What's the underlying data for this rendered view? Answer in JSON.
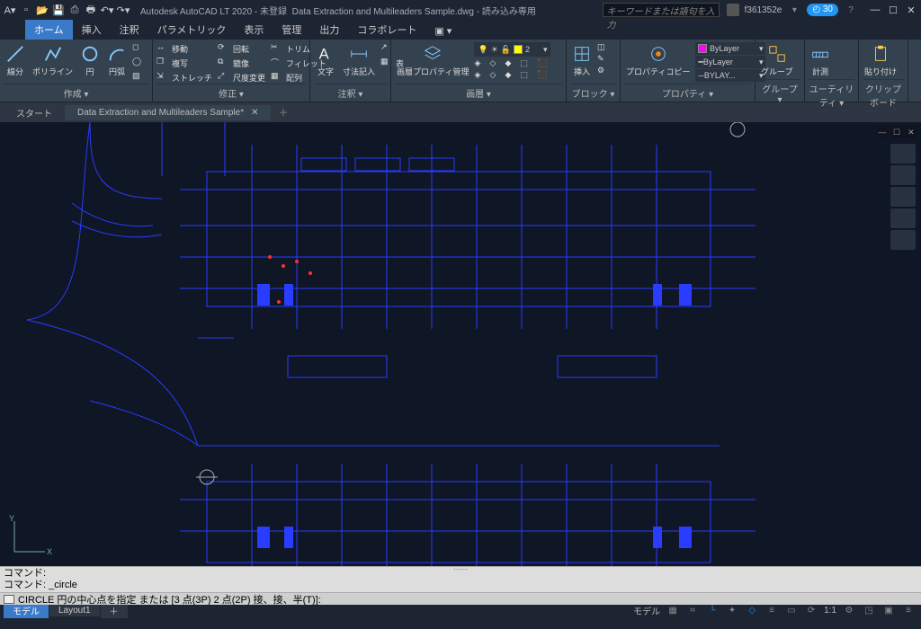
{
  "app": {
    "title": "Autodesk AutoCAD LT 2020 - 未登録",
    "file": "Data Extraction and Multileaders Sample.dwg",
    "readonly": "読み込み専用",
    "search_placeholder": "キーワードまたは語句を入力",
    "user": "f361352e",
    "badge": "30"
  },
  "ribbon": {
    "tabs": [
      "ホーム",
      "挿入",
      "注釈",
      "パラメトリック",
      "表示",
      "管理",
      "出力",
      "コラボレート"
    ],
    "active": 0,
    "panels": {
      "create": "作成 ▾",
      "modify": "修正 ▾",
      "anno": "注釈 ▾",
      "layer": "画層 ▾",
      "block": "ブロック ▾",
      "prop": "プロパティ ▾",
      "group": "グループ ▾",
      "util": "ユーティリティ ▾",
      "clip": "クリップボード"
    },
    "tools": {
      "line": "線分",
      "polyline": "ポリライン",
      "circle": "円",
      "arc": "円弧",
      "move": "移動",
      "rotate": "回転",
      "trim": "トリム",
      "copy": "複写",
      "mirror": "鏡像",
      "fillet": "フィレット",
      "stretch": "ストレッチ",
      "scale": "尺度変更",
      "array": "配列",
      "text": "文字",
      "dim": "寸法記入",
      "table": "表",
      "layerprop": "画層プロパティ管理",
      "insert": "挿入",
      "propcopy": "プロパティコピー",
      "group_btn": "グループ",
      "measure": "計測",
      "paste": "貼り付け",
      "bylayer": "ByLayer",
      "bylay2": "BYLAY..."
    },
    "current_layer": "2"
  },
  "docs": {
    "start": "スタート",
    "active": "Data Extraction and Multileaders Sample*"
  },
  "cmd": {
    "hist1": "コマンド:",
    "hist2": "コマンド: _circle",
    "prompt": "CIRCLE 円の中心点を指定 または [3 点(3P) 2 点(2P) 接、接、半(T)]:"
  },
  "layouts": {
    "model": "モデル",
    "l1": "Layout1"
  },
  "status": {
    "model": "モデル",
    "ratio": "1:1"
  }
}
